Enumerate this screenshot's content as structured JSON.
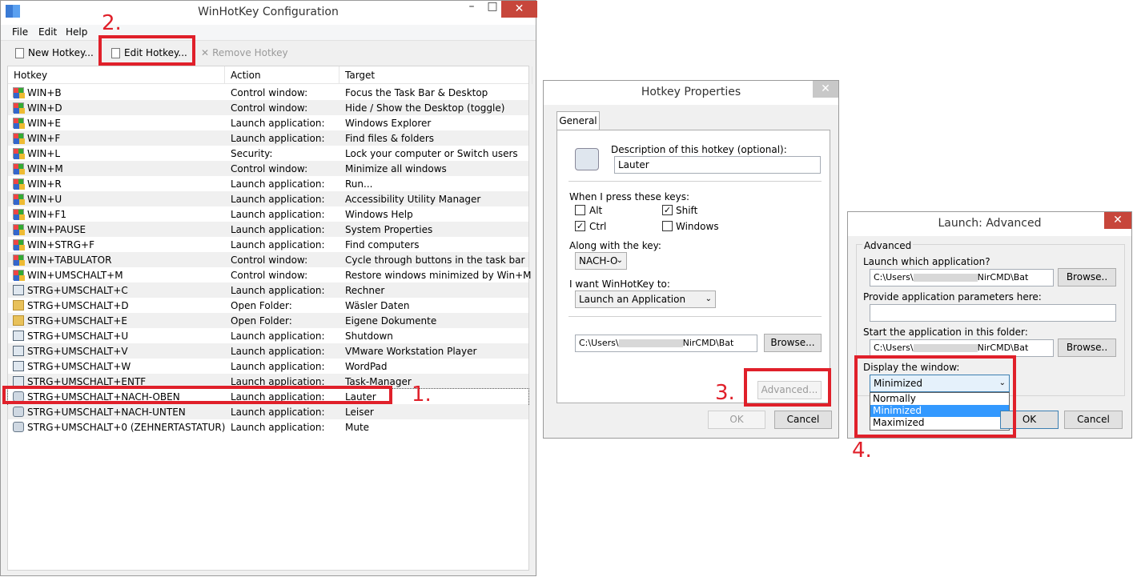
{
  "main": {
    "title": "WinHotKey Configuration",
    "menu": [
      "File",
      "Edit",
      "Help"
    ],
    "toolbar": {
      "new": "New Hotkey...",
      "edit": "Edit Hotkey...",
      "remove": "Remove Hotkey"
    },
    "columns": [
      "Hotkey",
      "Action",
      "Target"
    ],
    "rows": [
      {
        "hotkey": "WIN+B",
        "action": "Control window:",
        "target": "Focus the Task Bar & Desktop",
        "icon": "windows-logo-icon"
      },
      {
        "hotkey": "WIN+D",
        "action": "Control window:",
        "target": "Hide / Show the Desktop (toggle)",
        "icon": "windows-logo-icon"
      },
      {
        "hotkey": "WIN+E",
        "action": "Launch application:",
        "target": "Windows Explorer",
        "icon": "windows-logo-icon"
      },
      {
        "hotkey": "WIN+F",
        "action": "Launch application:",
        "target": "Find files & folders",
        "icon": "windows-logo-icon"
      },
      {
        "hotkey": "WIN+L",
        "action": "Security:",
        "target": "Lock your computer or Switch users",
        "icon": "windows-logo-icon"
      },
      {
        "hotkey": "WIN+M",
        "action": "Control window:",
        "target": "Minimize all windows",
        "icon": "windows-logo-icon"
      },
      {
        "hotkey": "WIN+R",
        "action": "Launch application:",
        "target": "Run...",
        "icon": "windows-logo-icon"
      },
      {
        "hotkey": "WIN+U",
        "action": "Launch application:",
        "target": "Accessibility Utility Manager",
        "icon": "windows-logo-icon"
      },
      {
        "hotkey": "WIN+F1",
        "action": "Launch application:",
        "target": "Windows Help",
        "icon": "windows-logo-icon"
      },
      {
        "hotkey": "WIN+PAUSE",
        "action": "Launch application:",
        "target": "System Properties",
        "icon": "windows-logo-icon"
      },
      {
        "hotkey": "WIN+STRG+F",
        "action": "Launch application:",
        "target": "Find computers",
        "icon": "windows-logo-icon"
      },
      {
        "hotkey": "WIN+TABULATOR",
        "action": "Control window:",
        "target": "Cycle through buttons in the task bar",
        "icon": "windows-logo-icon"
      },
      {
        "hotkey": "WIN+UMSCHALT+M",
        "action": "Control window:",
        "target": "Restore windows minimized by Win+M",
        "icon": "windows-logo-icon"
      },
      {
        "hotkey": "STRG+UMSCHALT+C",
        "action": "Launch application:",
        "target": "Rechner",
        "icon": "calculator-icon"
      },
      {
        "hotkey": "STRG+UMSCHALT+D",
        "action": "Open Folder:",
        "target": "Wäsler Daten",
        "icon": "folder-icon"
      },
      {
        "hotkey": "STRG+UMSCHALT+E",
        "action": "Open Folder:",
        "target": "Eigene Dokumente",
        "icon": "folder-icon"
      },
      {
        "hotkey": "STRG+UMSCHALT+U",
        "action": "Launch application:",
        "target": "Shutdown",
        "icon": "app-icon"
      },
      {
        "hotkey": "STRG+UMSCHALT+V",
        "action": "Launch application:",
        "target": "VMware Workstation Player",
        "icon": "vmware-icon"
      },
      {
        "hotkey": "STRG+UMSCHALT+W",
        "action": "Launch application:",
        "target": "WordPad",
        "icon": "wordpad-icon"
      },
      {
        "hotkey": "STRG+UMSCHALT+ENTF",
        "action": "Launch application:",
        "target": "Task-Manager",
        "icon": "task-manager-icon"
      },
      {
        "hotkey": "STRG+UMSCHALT+NACH-OBEN",
        "action": "Launch application:",
        "target": "Lauter",
        "icon": "gear-icon"
      },
      {
        "hotkey": "STRG+UMSCHALT+NACH-UNTEN",
        "action": "Launch application:",
        "target": "Leiser",
        "icon": "gear-icon"
      },
      {
        "hotkey": "STRG+UMSCHALT+0 (ZEHNERTASTATUR)",
        "action": "Launch application:",
        "target": "Mute",
        "icon": "gear-icon"
      }
    ]
  },
  "props": {
    "title": "Hotkey Properties",
    "tab": "General",
    "desc_label": "Description of this hotkey (optional):",
    "desc_value": "Lauter",
    "when_label": "When I press these keys:",
    "alt": "Alt",
    "shift": "Shift",
    "ctrl": "Ctrl",
    "windows": "Windows",
    "along_label": "Along with the key:",
    "key_value": "NACH-O",
    "want_label": "I want WinHotKey to:",
    "want_value": "Launch an Application",
    "path_start": "C:\\Users\\",
    "path_end": "NirCMD\\Bat",
    "browse": "Browse...",
    "advanced": "Advanced...",
    "ok": "OK",
    "cancel": "Cancel"
  },
  "adv": {
    "title": "Launch: Advanced",
    "group": "Advanced",
    "app_label": "Launch which application?",
    "path_start": "C:\\Users\\",
    "path_end": "NirCMD\\Bat",
    "browse": "Browse..",
    "params_label": "Provide application parameters here:",
    "folder_label": "Start the application in this folder:",
    "folder_start": "C:\\Users\\",
    "folder_end": "NirCMD\\Bat",
    "display_label": "Display the window:",
    "display_value": "Minimized",
    "options": [
      "Normally",
      "Minimized",
      "Maximized"
    ],
    "ok": "OK",
    "cancel": "Cancel"
  },
  "annotations": [
    "1.",
    "2.",
    "3.",
    "4."
  ],
  "colors": {
    "annotation": "#e0202a",
    "selection": "#3399ff"
  }
}
